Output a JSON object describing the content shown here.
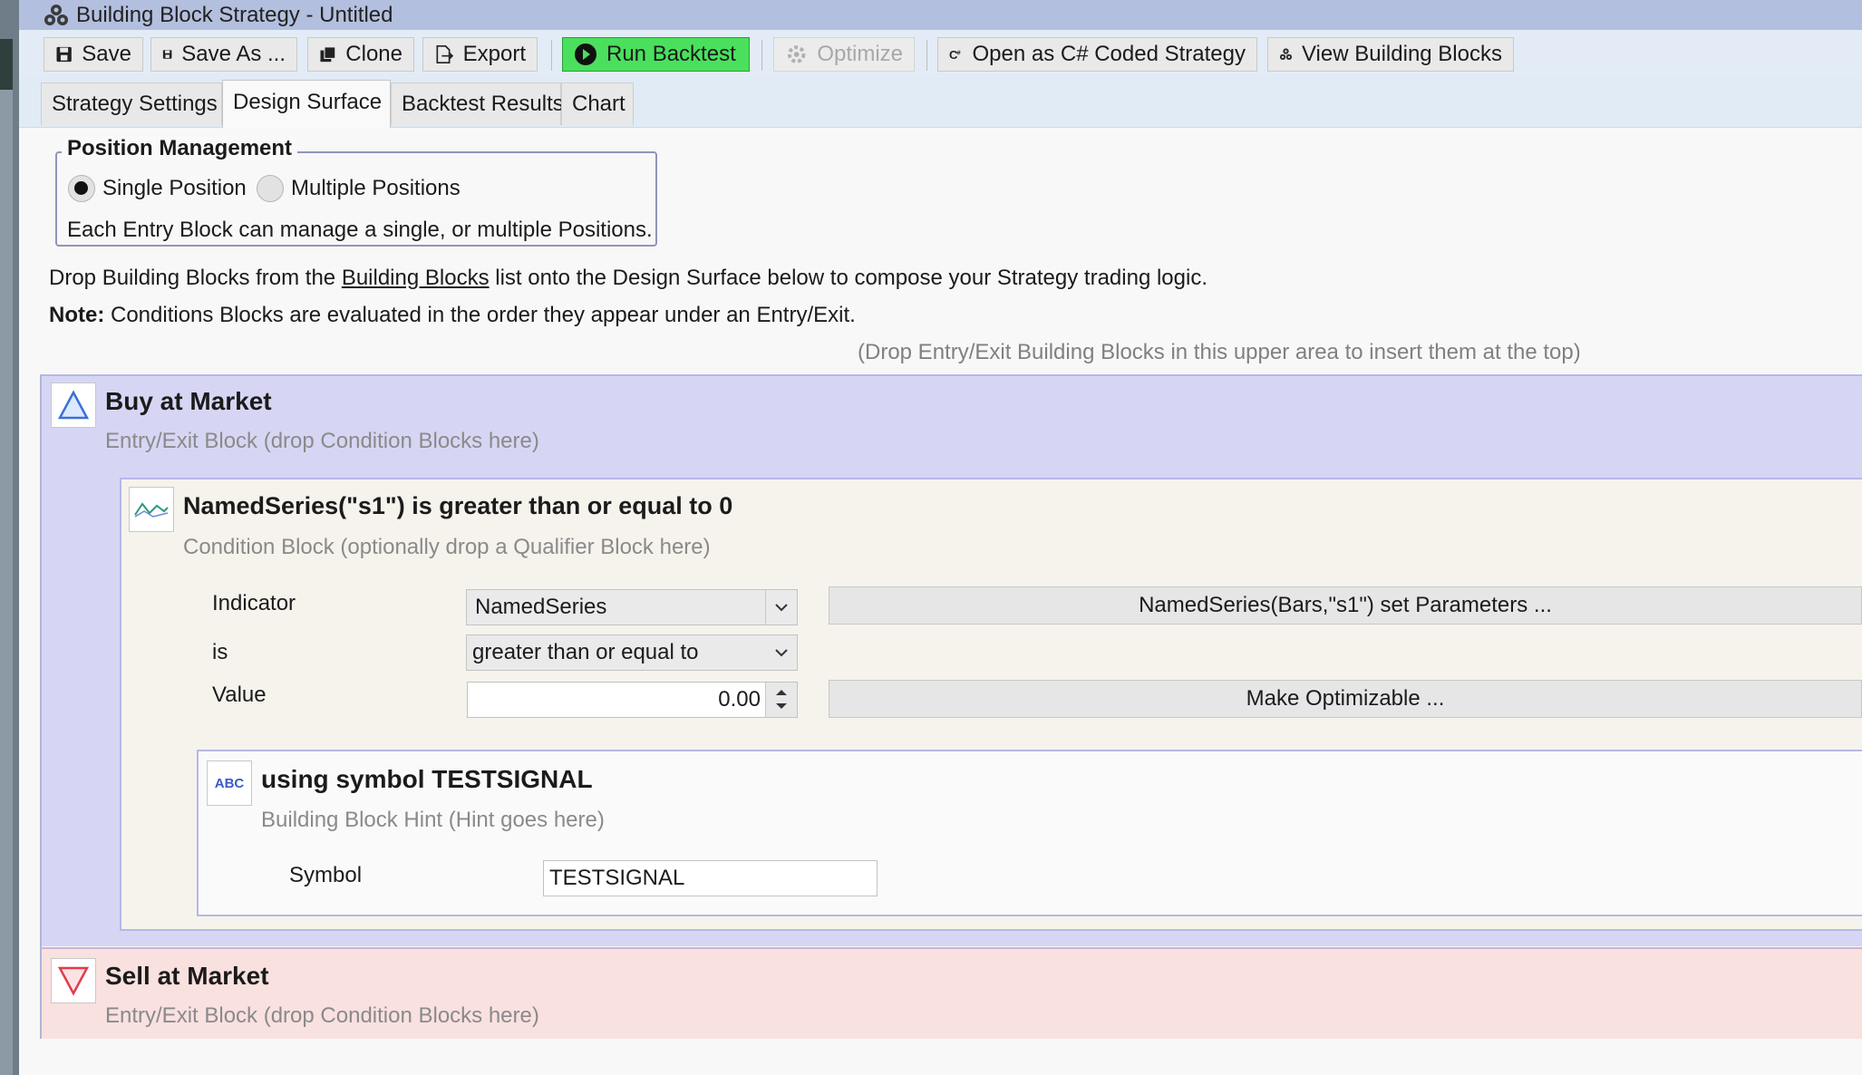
{
  "window": {
    "title": "Building Block Strategy - Untitled",
    "title_icon": "building-blocks-icon"
  },
  "toolbar": {
    "save": "Save",
    "save_as": "Save As ...",
    "clone": "Clone",
    "export": "Export",
    "run_backtest": "Run Backtest",
    "optimize": "Optimize",
    "open_csharp": "Open as C# Coded Strategy",
    "view_blocks": "View Building Blocks"
  },
  "tabs": [
    {
      "label": "Strategy Settings",
      "active": false
    },
    {
      "label": "Design Surface",
      "active": true
    },
    {
      "label": "Backtest Results",
      "active": false
    },
    {
      "label": "Chart",
      "active": false
    }
  ],
  "position_management": {
    "title": "Position Management",
    "single": "Single Position",
    "multiple": "Multiple Positions",
    "selected": "Single Position",
    "description": "Each Entry Block can manage a single, or multiple Positions."
  },
  "instructions": {
    "line1_pre": "Drop Building Blocks from the ",
    "line1_link": "Building Blocks",
    "line1_post": " list onto the Design Surface below to compose your Strategy trading logic.",
    "note_label": "Note:",
    "note_text": " Conditions Blocks are evaluated in the order they appear under an Entry/Exit.",
    "drop_hint": "(Drop Entry/Exit Building Blocks in this upper area to insert them at the top)"
  },
  "buy_block": {
    "title": "Buy at Market",
    "hint": "Entry/Exit Block (drop Condition Blocks here)"
  },
  "condition_block": {
    "title": "NamedSeries(\"s1\") is greater than or equal to 0",
    "hint": "Condition Block (optionally drop a Qualifier Block here)",
    "indicator_label": "Indicator",
    "indicator_value": "NamedSeries",
    "is_label": "is",
    "is_value": "greater than or equal to",
    "value_label": "Value",
    "value": "0.00",
    "set_params_button": "NamedSeries(Bars,\"s1\") set Parameters ...",
    "make_optimizable_button": "Make Optimizable ..."
  },
  "qualifier_block": {
    "icon_text": "ABC",
    "title": "using symbol TESTSIGNAL",
    "hint": "Building Block Hint (Hint goes here)",
    "symbol_label": "Symbol",
    "symbol_value": "TESTSIGNAL"
  },
  "sell_block": {
    "title": "Sell at Market",
    "hint": "Entry/Exit Block (drop Condition Blocks here)"
  },
  "colors": {
    "run_backtest": "#4ae05d",
    "buy_panel": "#d6d6f4",
    "sell_panel": "#f9e1df",
    "buy_triangle": "#3a6fd8",
    "sell_triangle": "#e23b4a"
  }
}
